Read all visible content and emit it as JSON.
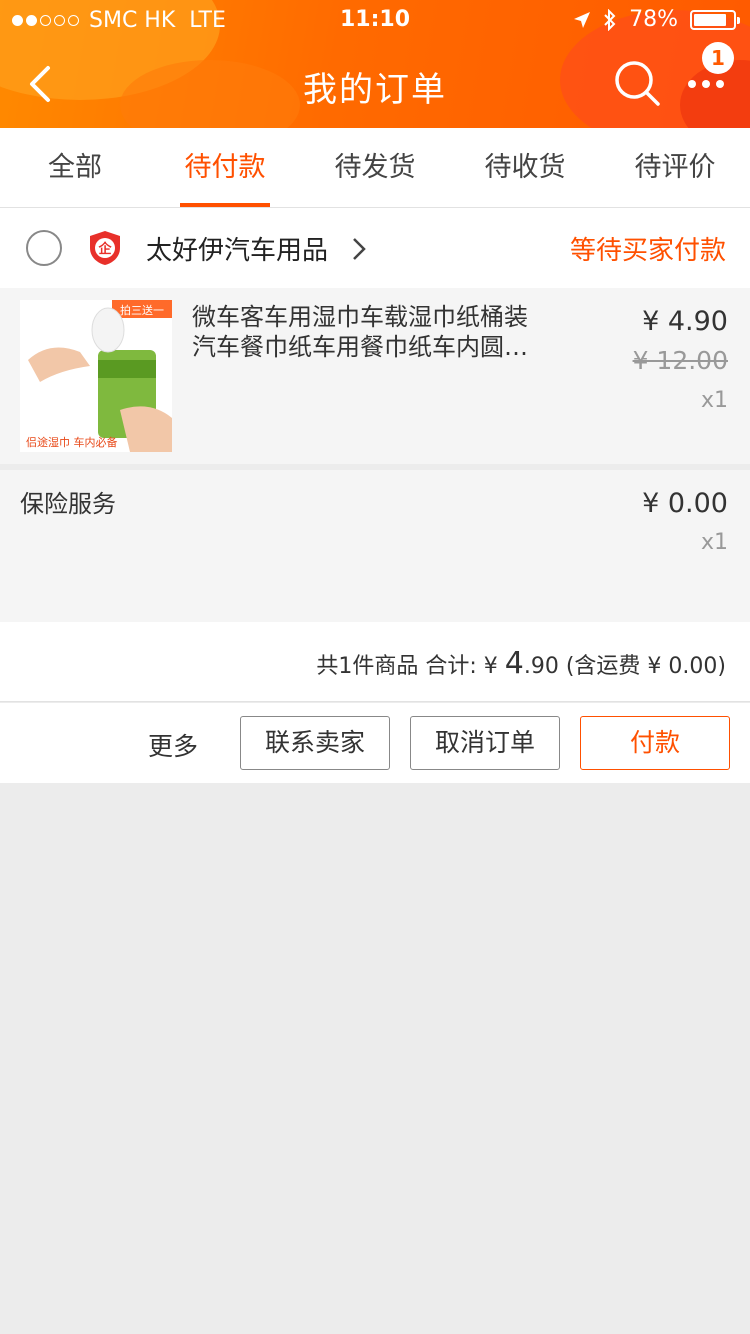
{
  "status_bar": {
    "carrier": "SMC HK",
    "network": "LTE",
    "time": "11:10",
    "battery": "78%",
    "signal_bars": 2,
    "signal_total": 5
  },
  "nav": {
    "title": "我的订单",
    "badge_count": "1"
  },
  "tabs": [
    {
      "label": "全部",
      "active": false
    },
    {
      "label": "待付款",
      "active": true
    },
    {
      "label": "待发货",
      "active": false
    },
    {
      "label": "待收货",
      "active": false
    },
    {
      "label": "待评价",
      "active": false
    }
  ],
  "order": {
    "shop_name": "太好伊汽车用品",
    "status": "等待买家付款",
    "item": {
      "title_line1": "微车客车用湿巾车载湿巾纸桶装",
      "title_line2": "汽车餐巾纸车用餐巾纸车内圆…",
      "price": "¥ 4.90",
      "original_price": "¥ 12.00",
      "qty": "x1",
      "thumb_tag": "拍三送一",
      "thumb_caption": "侣途湿巾 车内必备"
    },
    "insurance": {
      "label": "保险服务",
      "price": "¥ 0.00",
      "qty": "x1"
    },
    "summary": {
      "prefix": "共1件商品 合计: ¥ ",
      "total_int": "4",
      "total_dec": ".90",
      "shipping": " (含运费 ¥ 0.00)"
    },
    "actions": {
      "more": "更多",
      "contact": "联系卖家",
      "cancel": "取消订单",
      "pay": "付款"
    }
  },
  "colors": {
    "accent": "#ff5000",
    "header_start": "#ff8a00",
    "header_end": "#ff5a00"
  }
}
